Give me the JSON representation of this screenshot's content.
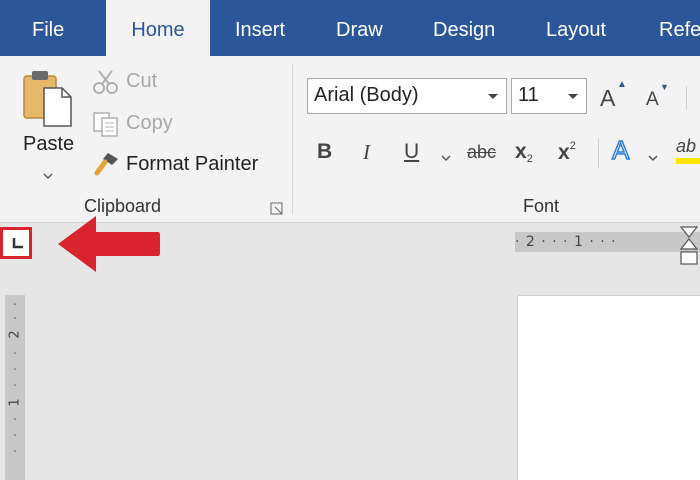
{
  "tabs": [
    {
      "label": "File"
    },
    {
      "label": "Home",
      "active": true
    },
    {
      "label": "Insert"
    },
    {
      "label": "Draw"
    },
    {
      "label": "Design"
    },
    {
      "label": "Layout"
    },
    {
      "label": "Refe"
    }
  ],
  "clipboard": {
    "paste_label": "Paste",
    "cut_label": "Cut",
    "copy_label": "Copy",
    "format_painter_label": "Format Painter",
    "group_label": "Clipboard"
  },
  "font": {
    "font_name": "Arial (Body)",
    "font_size": "11",
    "group_label": "Font",
    "grow_label": "A",
    "shrink_label": "A",
    "bold": "B",
    "italic": "I",
    "underline": "U",
    "strikethrough": "abc",
    "subscript_base": "x",
    "subscript_mark": "2",
    "superscript_base": "x",
    "superscript_mark": "2",
    "text_effects": "A",
    "highlight_label": "ab"
  },
  "ruler": {
    "horizontal_text": "· 2 · · · 1 · · ·",
    "vertical_marks": [
      "2",
      "1"
    ]
  },
  "colors": {
    "tab_bar": "#2b579a",
    "ribbon": "#f3f3f3",
    "highlight_marker": "#d9232e",
    "workspace": "#e6e6e6"
  },
  "icons": [
    "paste-icon",
    "scissors-icon",
    "copy-icon",
    "format-painter-icon",
    "dialog-launcher-icon",
    "tab-stop-icon",
    "red-arrow-icon",
    "indent-marker-icon"
  ]
}
